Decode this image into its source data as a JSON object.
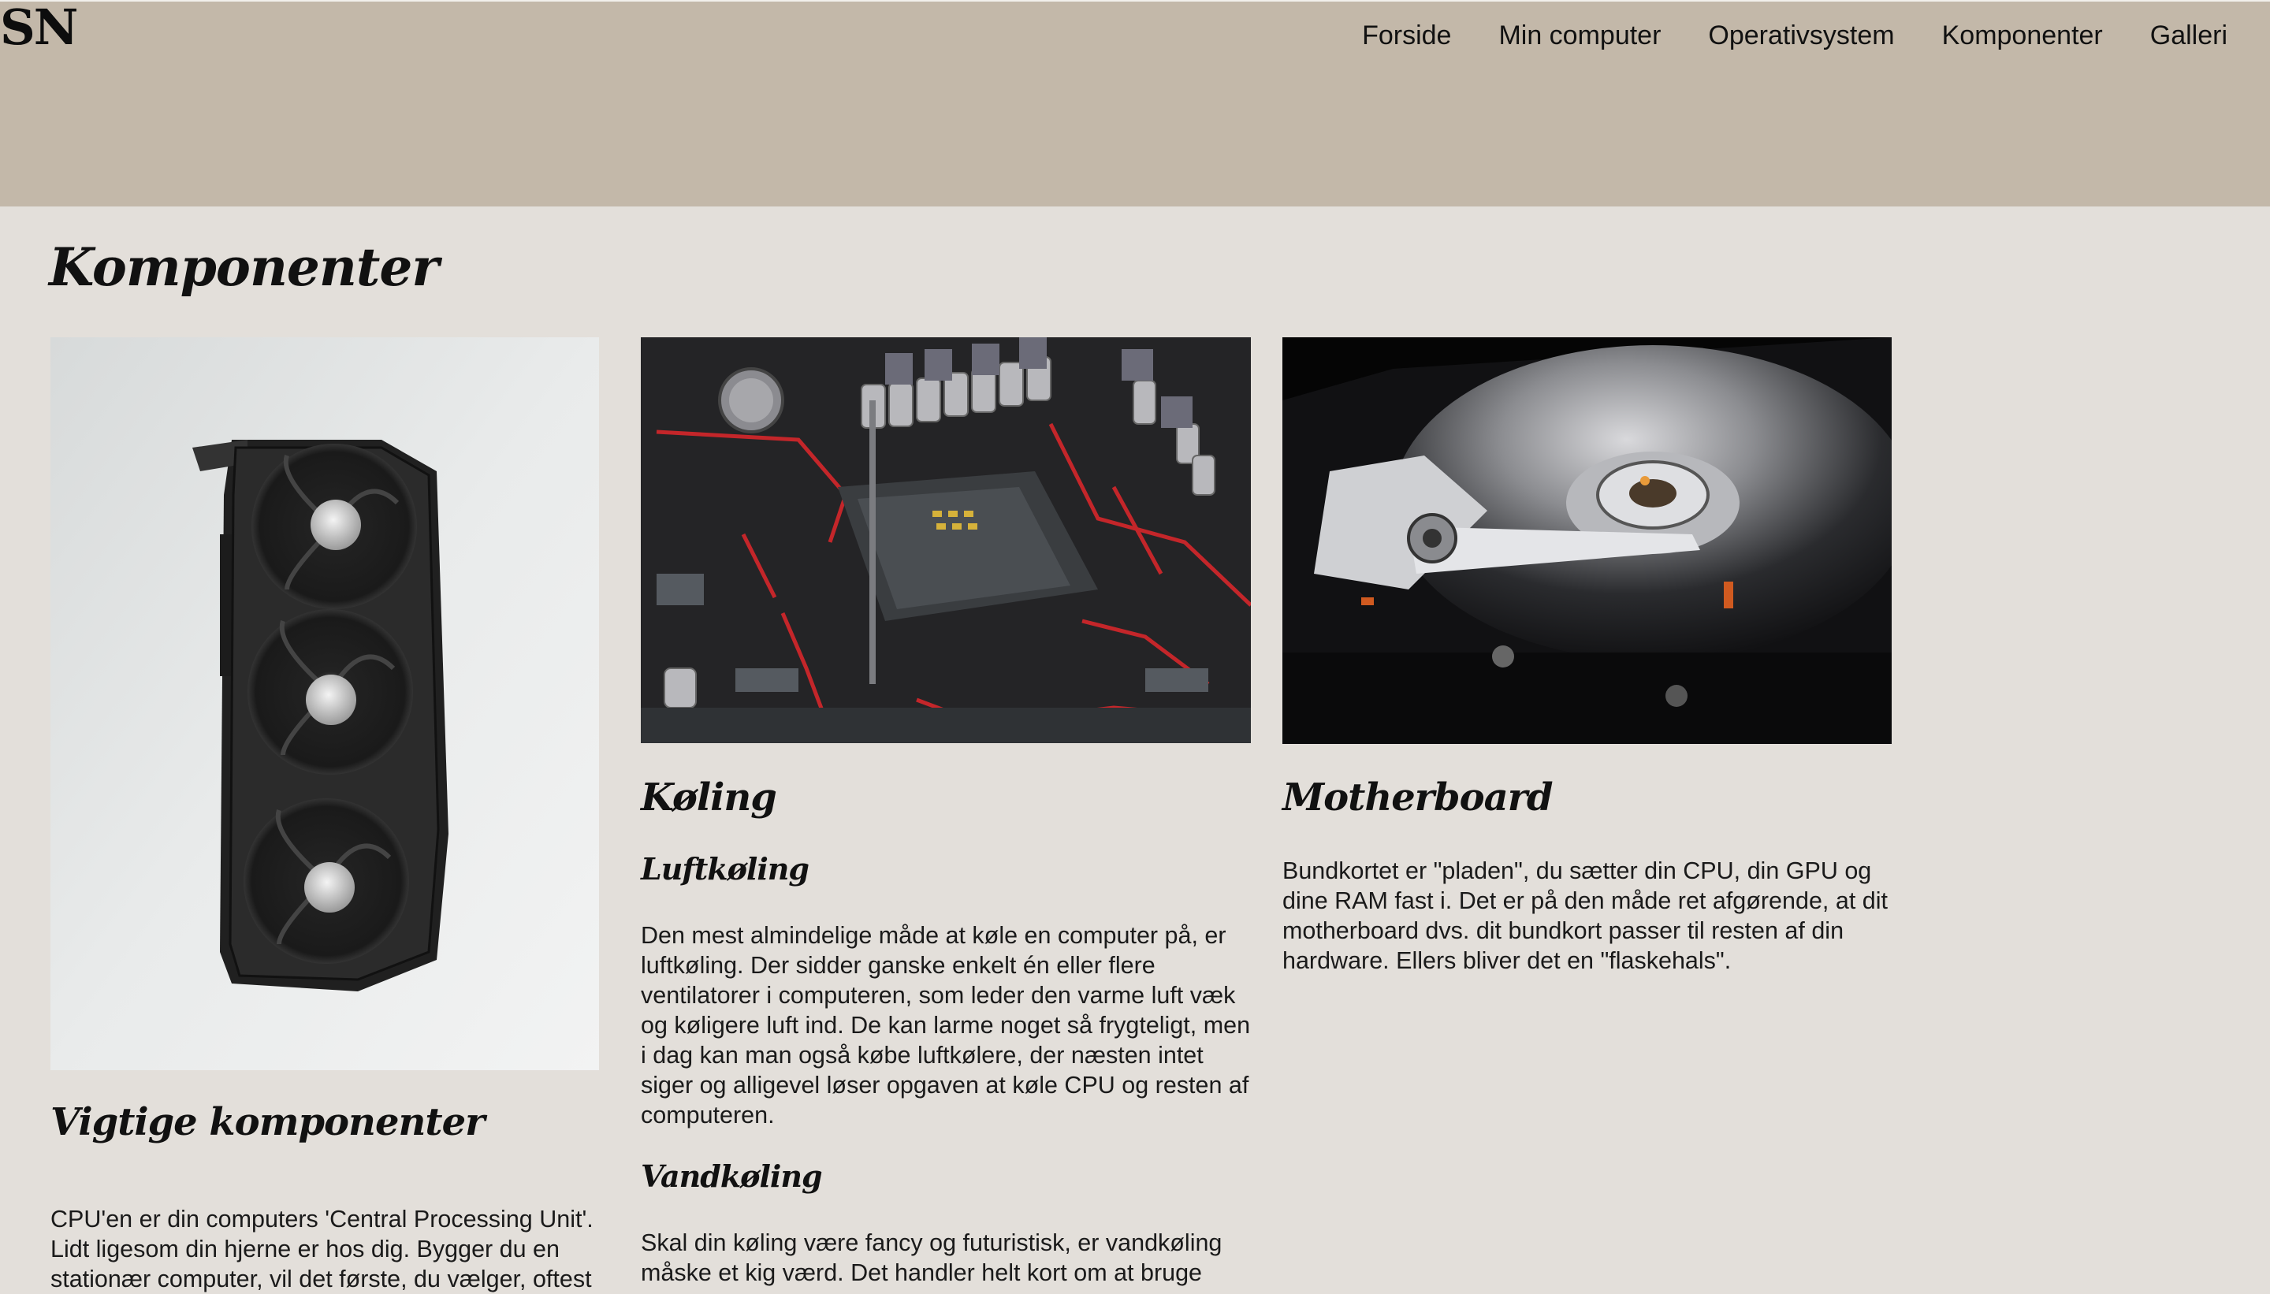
{
  "header": {
    "logo": "SN",
    "nav": [
      "Forside",
      "Min computer",
      "Operativsystem",
      "Komponenter",
      "Galleri"
    ]
  },
  "main": {
    "page_title": "Komponenter",
    "columns": [
      {
        "image_alt": "graphics-card-image",
        "heading": "Vigtige komponenter",
        "text": "CPU'en er din computers 'Central Processing Unit'. Lidt ligesom din hjerne er hos dig. Bygger du en stationær computer, vil det første, du vælger, oftest"
      },
      {
        "image_alt": "motherboard-socket-image",
        "heading": "Køling",
        "sub1": "Luftkøling",
        "text1": "Den mest almindelige måde at køle en computer på, er luftkøling. Der sidder ganske enkelt én eller flere ventilatorer i computeren, som leder den varme luft væk og køligere luft ind. De kan larme noget så frygteligt, men i dag kan man også købe luftkølere, der næsten intet siger og alligevel løser opgaven at køle CPU og resten af computeren.",
        "sub2": "Vandkøling",
        "text2": "Skal din køling være fancy og futuristisk, er vandkøling måske et kig værd. Det handler helt kort om at bruge"
      },
      {
        "image_alt": "hard-drive-image",
        "heading": "Motherboard",
        "text": "Bundkortet er \"pladen\", du sætter din CPU, din GPU og dine RAM fast i. Det er på den måde ret afgørende, at dit motherboard dvs. dit bundkort passer til resten af din hardware. Ellers bliver det en \"flaskehals\"."
      }
    ]
  }
}
